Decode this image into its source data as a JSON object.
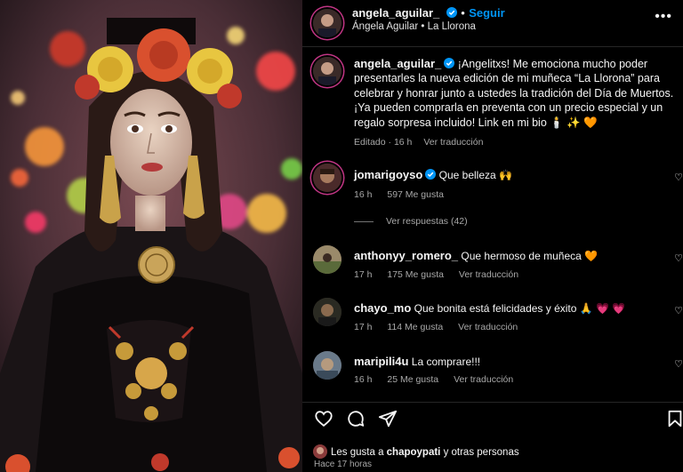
{
  "post": {
    "author": "angela_aguilar_",
    "follow_label": "Seguir",
    "location": "Ángela Aguilar • La Llorona",
    "more_label": "•••"
  },
  "caption": {
    "username": "angela_aguilar_",
    "text": "¡Angelitxs! Me emociona mucho poder presentarles la nueva edición de mi muñeca “La Llorona” para celebrar y honrar junto a ustedes la tradición del Día de Muertos. ¡Ya pueden comprarla en preventa con un precio especial y un regalo sorpresa incluido! Link en mi bio 🕯️ ✨ 🧡",
    "edited": "Editado · 16 h",
    "translate": "Ver traducción"
  },
  "comments": [
    {
      "username": "jomarigoyso",
      "verified": true,
      "text": "Que belleza 🙌",
      "time": "16 h",
      "likes": "597 Me gusta",
      "translate": "",
      "replies": "Ver respuestas (42)"
    },
    {
      "username": "anthonyy_romero_",
      "verified": false,
      "text": "Que hermoso de muñeca 🧡",
      "time": "17 h",
      "likes": "175 Me gusta",
      "translate": "Ver traducción",
      "replies": ""
    },
    {
      "username": "chayo_mo",
      "verified": false,
      "text": "Que bonita está felicidades y éxito 🙏 💗 💗",
      "time": "17 h",
      "likes": "114 Me gusta",
      "translate": "Ver traducción",
      "replies": ""
    },
    {
      "username": "maripili4u",
      "verified": false,
      "text": "La comprare!!!",
      "time": "16 h",
      "likes": "25 Me gusta",
      "translate": "Ver traducción",
      "replies": ""
    }
  ],
  "likes": {
    "prefix": "Les gusta a ",
    "user": "chapoypati",
    "suffix": " y otras personas"
  },
  "posted_ago": "Hace 17 horas",
  "colors": {
    "accent": "#0095f6",
    "verified": "#0095f6",
    "background": "#000000",
    "muted": "#a8a8a8"
  }
}
